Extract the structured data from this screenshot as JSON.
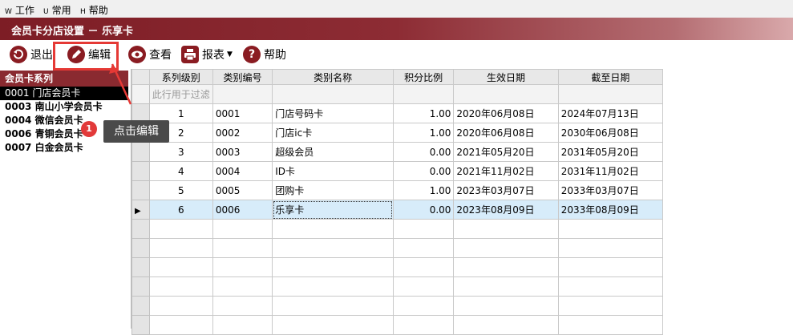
{
  "menu": [
    {
      "hotkey": "W",
      "label": "工作"
    },
    {
      "hotkey": "U",
      "label": "常用"
    },
    {
      "hotkey": "H",
      "label": "帮助"
    }
  ],
  "window_title": "会员卡分店设置 － 乐享卡",
  "toolbar": {
    "exit_label": "退出",
    "edit_label": "编辑",
    "view_label": "查看",
    "report_label": "报表",
    "help_label": "帮助"
  },
  "sidebar": {
    "header": "会员卡系列",
    "items": [
      {
        "code": "0001",
        "name": "门店会员卡"
      },
      {
        "code": "0003",
        "name": "南山小学会员卡"
      },
      {
        "code": "0004",
        "name": "微信会员卡"
      },
      {
        "code": "0006",
        "name": "青铜会员卡"
      },
      {
        "code": "0007",
        "name": "白金会员卡"
      }
    ]
  },
  "grid": {
    "columns": [
      "系列级别",
      "类别编号",
      "类别名称",
      "积分比例",
      "生效日期",
      "截至日期"
    ],
    "filter_placeholder": "此行用于过滤",
    "rows": [
      [
        "1",
        "0001",
        "门店号码卡",
        "1.00",
        "2020年06月08日",
        "2024年07月13日"
      ],
      [
        "2",
        "0002",
        "门店ic卡",
        "1.00",
        "2020年06月08日",
        "2030年06月08日"
      ],
      [
        "3",
        "0003",
        "超级会员",
        "0.00",
        "2021年05月20日",
        "2031年05月20日"
      ],
      [
        "4",
        "0004",
        "ID卡",
        "0.00",
        "2021年11月02日",
        "2031年11月02日"
      ],
      [
        "5",
        "0005",
        "团购卡",
        "1.00",
        "2023年03月07日",
        "2033年03月07日"
      ],
      [
        "6",
        "0006",
        "乐享卡",
        "0.00",
        "2023年08月09日",
        "2033年08月09日"
      ]
    ]
  },
  "callout": {
    "badge": "1",
    "text": "点击编辑"
  },
  "colors": {
    "title_bar": "#8d2c34",
    "accent": "#8a1c22",
    "selected_row": "#d7ecfa",
    "highlight": "#e53935"
  }
}
